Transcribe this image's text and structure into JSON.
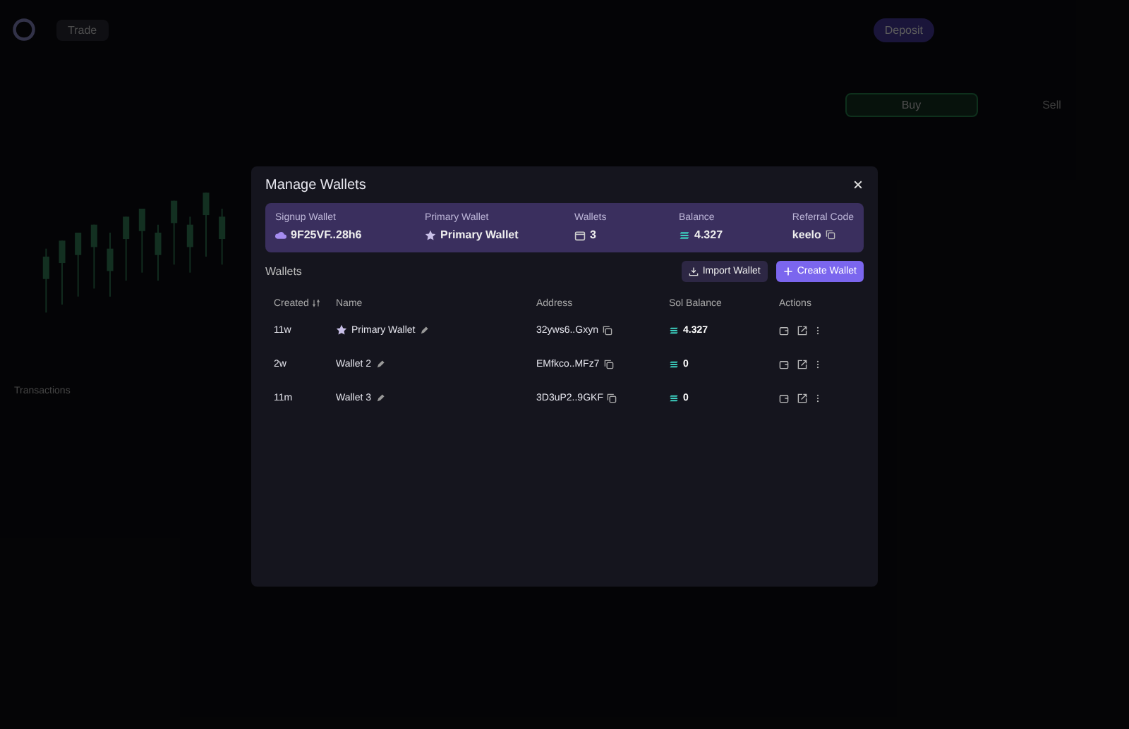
{
  "background": {
    "nav_active": "Trade",
    "deposit_button": "Deposit",
    "buy_tab": "Buy",
    "sell_tab": "Sell",
    "transactions_tab": "Transactions"
  },
  "modal": {
    "title": "Manage Wallets",
    "summary": [
      {
        "label": "Signup Wallet",
        "value": "9F25VF..28h6",
        "kind": "signup"
      },
      {
        "label": "Primary Wallet",
        "value": "Primary Wallet",
        "kind": "primary"
      },
      {
        "label": "Wallets",
        "value": "3",
        "kind": "count"
      },
      {
        "label": "Balance",
        "value": "4.327",
        "kind": "balance"
      },
      {
        "label": "Referral Code",
        "value": "keelo",
        "kind": "referral"
      }
    ],
    "section_title": "Wallets",
    "buttons": [
      {
        "label": "Import Wallet",
        "kind": "import"
      },
      {
        "label": "Create Wallet",
        "kind": "create"
      }
    ],
    "table": {
      "columns": [
        "Created",
        "Name",
        "Address",
        "Sol Balance",
        "Actions"
      ],
      "rows": [
        {
          "created": "11w",
          "name": "Primary Wallet",
          "primary": true,
          "address": "32yws6..Gxyn",
          "balance": "4.327"
        },
        {
          "created": "2w",
          "name": "Wallet 2",
          "primary": false,
          "address": "EMfkco..MFz7",
          "balance": "0"
        },
        {
          "created": "11m",
          "name": "Wallet 3",
          "primary": false,
          "address": "3D3uP2..9GKF",
          "balance": "0"
        }
      ]
    }
  }
}
